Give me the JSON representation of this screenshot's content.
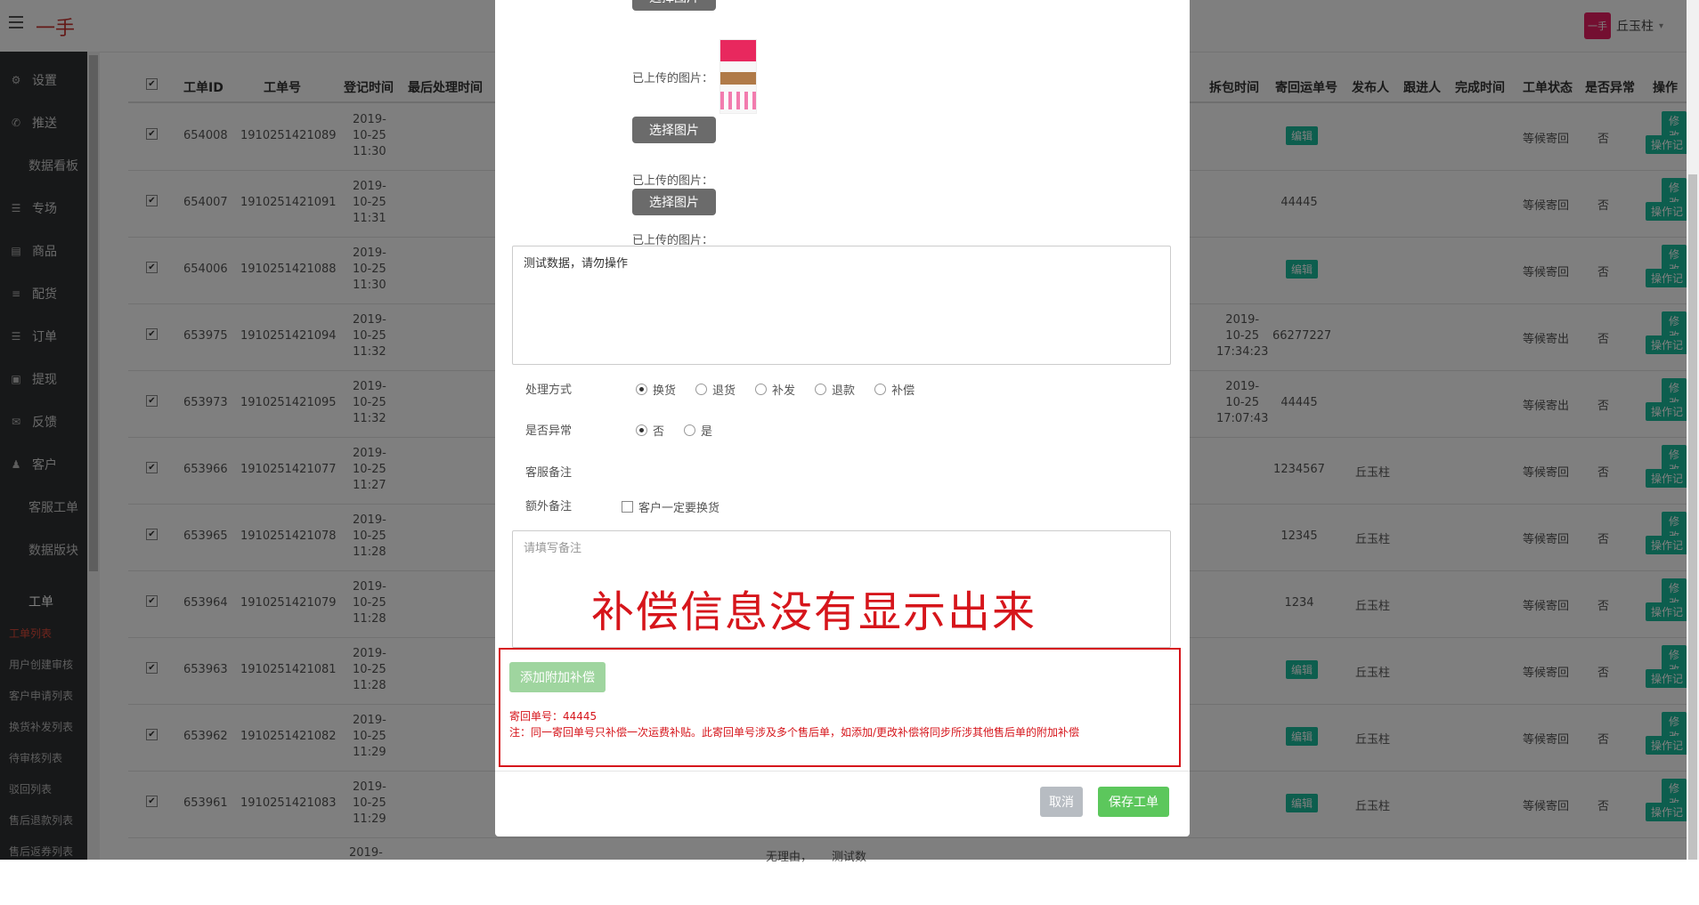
{
  "header": {
    "brand": "一手",
    "user_name": "丘玉柱",
    "avatar_text": "一手"
  },
  "sidebar": {
    "items": [
      {
        "icon": "⚙",
        "label": "设置"
      },
      {
        "icon": "✆",
        "label": "推送"
      },
      {
        "icon": "",
        "label": "数据看板"
      },
      {
        "icon": "☰",
        "label": "专场"
      },
      {
        "icon": "▤",
        "label": "商品"
      },
      {
        "icon": "≡",
        "label": "配货"
      },
      {
        "icon": "☰",
        "label": "订单"
      },
      {
        "icon": "▣",
        "label": "提现"
      },
      {
        "icon": "✉",
        "label": "反馈"
      },
      {
        "icon": "♟",
        "label": "客户"
      },
      {
        "icon": "",
        "label": "客服工单"
      },
      {
        "icon": "",
        "label": "数据版块"
      }
    ],
    "section": "工单",
    "links": [
      "工单列表",
      "用户创建审核",
      "客户申请列表",
      "换货补发列表",
      "待审核列表",
      "驳回列表",
      "售后退款列表",
      "售后返券列表"
    ]
  },
  "table": {
    "headers": [
      "工单ID",
      "工单号",
      "登记时间",
      "最后处理时间",
      "拆包时间",
      "寄回运单号",
      "发布人",
      "跟进人",
      "完成时间",
      "工单状态",
      "是否异常",
      "操作"
    ],
    "rows": [
      {
        "id": "654008",
        "no": "1910251421089",
        "t1": "2019-",
        "t2": "10-25",
        "t3": "11:30",
        "unpack": [
          "",
          "",
          ""
        ],
        "ship": "",
        "ship_badge": "编辑",
        "publisher": "",
        "status": "等候寄回",
        "abnormal": "否"
      },
      {
        "id": "654007",
        "no": "1910251421091",
        "t1": "2019-",
        "t2": "10-25",
        "t3": "11:31",
        "unpack": [
          "",
          "",
          ""
        ],
        "ship": "44445",
        "ship_badge": "",
        "publisher": "",
        "status": "等候寄回",
        "abnormal": "否"
      },
      {
        "id": "654006",
        "no": "1910251421088",
        "t1": "2019-",
        "t2": "10-25",
        "t3": "11:30",
        "unpack": [
          "",
          "",
          ""
        ],
        "ship": "",
        "ship_badge": "编辑",
        "publisher": "",
        "status": "等候寄回",
        "abnormal": "否"
      },
      {
        "id": "653975",
        "no": "1910251421094",
        "t1": "2019-",
        "t2": "10-25",
        "t3": "11:32",
        "unpack": [
          "2019-",
          "10-25",
          "17:34:23"
        ],
        "ship": "66277227",
        "ship_badge": "",
        "publisher": "",
        "status": "等候寄出",
        "abnormal": "否"
      },
      {
        "id": "653973",
        "no": "1910251421095",
        "t1": "2019-",
        "t2": "10-25",
        "t3": "11:32",
        "unpack": [
          "2019-",
          "10-25",
          "17:07:43"
        ],
        "ship": "44445",
        "ship_badge": "",
        "publisher": "",
        "status": "等候寄出",
        "abnormal": "否"
      },
      {
        "id": "653966",
        "no": "1910251421077",
        "t1": "2019-",
        "t2": "10-25",
        "t3": "11:27",
        "unpack": [
          "",
          "",
          ""
        ],
        "ship": "1234567",
        "ship_badge": "",
        "publisher": "丘玉柱",
        "status": "等候寄回",
        "abnormal": "否"
      },
      {
        "id": "653965",
        "no": "1910251421078",
        "t1": "2019-",
        "t2": "10-25",
        "t3": "11:28",
        "unpack": [
          "",
          "",
          ""
        ],
        "ship": "12345",
        "ship_badge": "",
        "publisher": "丘玉柱",
        "status": "等候寄回",
        "abnormal": "否"
      },
      {
        "id": "653964",
        "no": "1910251421079",
        "t1": "2019-",
        "t2": "10-25",
        "t3": "11:28",
        "unpack": [
          "",
          "",
          ""
        ],
        "ship": "1234",
        "ship_badge": "",
        "publisher": "丘玉柱",
        "status": "等候寄回",
        "abnormal": "否"
      },
      {
        "id": "653963",
        "no": "1910251421081",
        "t1": "2019-",
        "t2": "10-25",
        "t3": "11:28",
        "unpack": [
          "",
          "",
          ""
        ],
        "ship": "",
        "ship_badge": "编辑",
        "publisher": "丘玉柱",
        "status": "等候寄回",
        "abnormal": "否"
      },
      {
        "id": "653962",
        "no": "1910251421082",
        "t1": "2019-",
        "t2": "10-25",
        "t3": "11:29",
        "unpack": [
          "",
          "",
          ""
        ],
        "ship": "",
        "ship_badge": "编辑",
        "publisher": "丘玉柱",
        "status": "等候寄回",
        "abnormal": "否"
      },
      {
        "id": "653961",
        "no": "1910251421083",
        "t1": "2019-",
        "t2": "10-25",
        "t3": "11:29",
        "unpack": [
          "",
          "",
          ""
        ],
        "ship": "",
        "ship_badge": "编辑",
        "publisher": "丘玉柱",
        "status": "等候寄回",
        "abnormal": "否"
      }
    ],
    "op_modify": "修改",
    "op_log": "操作记",
    "last_row_date": "2019-",
    "behind_text_1": "无理由，",
    "behind_text_2": "测试数"
  },
  "modal": {
    "select_image": "选择图片",
    "uploaded_label": "已上传的图片：",
    "desc_text": "测试数据，请勿操作",
    "method_label": "处理方式",
    "method_options": [
      "换货",
      "退货",
      "补发",
      "退款",
      "补偿"
    ],
    "abnormal_label": "是否异常",
    "abnormal_options": [
      "否",
      "是"
    ],
    "cs_note_label": "客服备注",
    "extra_note_label": "额外备注",
    "extra_checkbox": "客户一定要换货",
    "note_placeholder": "请填写备注",
    "overlay_text": "补偿信息没有显示出来",
    "add_comp_button": "添加附加补偿",
    "return_no_line": "寄回单号：44445",
    "notice_line": "注：同一寄回单号只补偿一次运费补贴。此寄回单号涉及多个售后单，如添加/更改补偿将同步所涉其他售后单的附加补偿",
    "cancel": "取消",
    "save": "保存工单"
  }
}
